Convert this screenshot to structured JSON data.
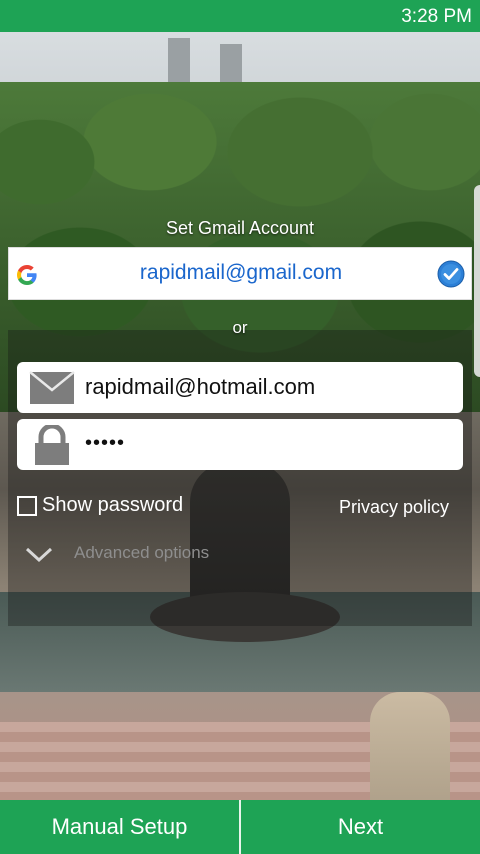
{
  "status_bar": {
    "time": "3:28 PM"
  },
  "gmail_section": {
    "title": "Set Gmail Account",
    "account": "rapidmail@gmail.com",
    "selected": true
  },
  "or_label": "or",
  "login_form": {
    "email_value": "rapidmail@hotmail.com",
    "password_value": "•••••",
    "show_password_label": "Show password",
    "show_password_checked": false,
    "privacy_label": "Privacy policy",
    "advanced_label": "Advanced options"
  },
  "bottom_buttons": {
    "manual_setup": "Manual Setup",
    "next": "Next"
  },
  "colors": {
    "brand_green": "#1ea355",
    "link_blue": "#1a66cc"
  },
  "icons": [
    "google-icon",
    "check-circle-icon",
    "envelope-icon",
    "lock-icon",
    "chevron-down-icon"
  ]
}
